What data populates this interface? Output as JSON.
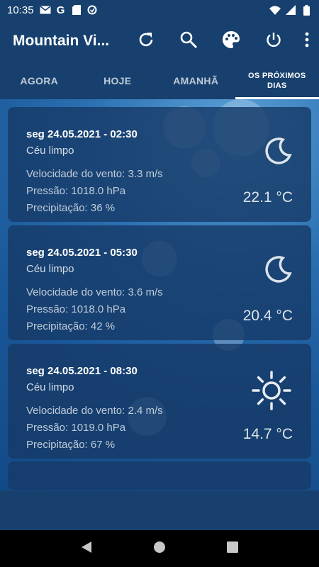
{
  "status_bar": {
    "time": "10:35",
    "left_icons": [
      "mail-icon",
      "google-icon",
      "sd-card-icon",
      "sync-icon"
    ],
    "right_icons": [
      "wifi-icon",
      "signal-icon",
      "battery-icon"
    ]
  },
  "app_bar": {
    "title": "Mountain Vi...",
    "actions": [
      "refresh-icon",
      "search-icon",
      "palette-icon",
      "power-icon",
      "more-icon"
    ]
  },
  "tabs": {
    "now": "AGORA",
    "today": "HOJE",
    "tomorrow": "AMANHÃ",
    "next_days": "OS PRÓXIMOS DIAS",
    "active": "next_days"
  },
  "forecasts": [
    {
      "datetime": "seg 24.05.2021 - 02:30",
      "condition": "Céu limpo",
      "wind": "Velocidade do vento: 3.3 m/s",
      "pressure": "Pressão: 1018.0 hPa",
      "precipitation": "Precipitação: 36 %",
      "temperature": "22.1 °C",
      "icon": "moon-icon"
    },
    {
      "datetime": "seg 24.05.2021 - 05:30",
      "condition": "Céu limpo",
      "wind": "Velocidade do vento: 3.6 m/s",
      "pressure": "Pressão: 1018.0 hPa",
      "precipitation": "Precipitação: 42 %",
      "temperature": "20.4 °C",
      "icon": "moon-icon"
    },
    {
      "datetime": "seg 24.05.2021 - 08:30",
      "condition": "Céu limpo",
      "wind": "Velocidade do vento: 2.4 m/s",
      "pressure": "Pressão: 1019.0 hPa",
      "precipitation": "Precipitação: 67 %",
      "temperature": "14.7 °C",
      "icon": "sun-icon"
    }
  ],
  "nav": [
    "back-icon",
    "home-icon",
    "recents-icon"
  ],
  "colors": {
    "app_bar": "#17406e",
    "card": "#163a68",
    "background_light": "#5a9fd6",
    "background_dark": "#124a86"
  }
}
